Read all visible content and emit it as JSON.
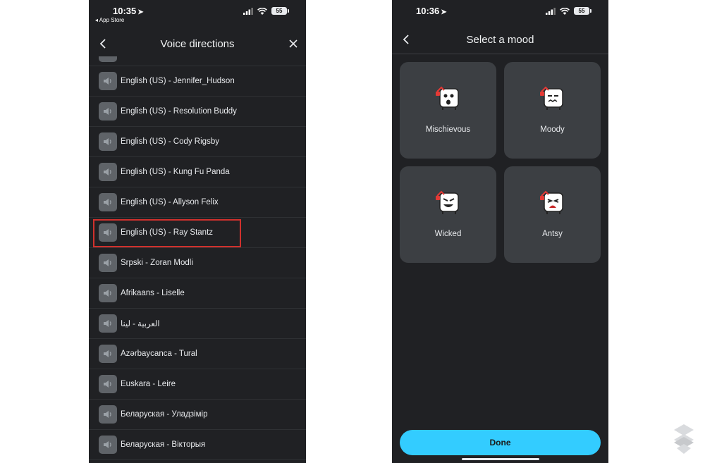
{
  "left_screen": {
    "status": {
      "time": "10:35",
      "back_to_app": "◂ App Store",
      "battery": "55"
    },
    "title": "Voice directions",
    "voices": [
      {
        "label": "English (US) - Jennifer_Hudson",
        "highlighted": false
      },
      {
        "label": "English (US) - Resolution Buddy",
        "highlighted": false
      },
      {
        "label": "English (US) - Cody Rigsby",
        "highlighted": false
      },
      {
        "label": "English (US) - Kung Fu Panda",
        "highlighted": false
      },
      {
        "label": "English (US) - Allyson Felix",
        "highlighted": false
      },
      {
        "label": "English (US) - Ray Stantz",
        "highlighted": true
      },
      {
        "label": "Srpski - Zoran Modli",
        "highlighted": false
      },
      {
        "label": "Afrikaans - Liselle",
        "highlighted": false
      },
      {
        "label": "العربية - لينا",
        "highlighted": false
      },
      {
        "label": "Azərbaycanca - Tural",
        "highlighted": false
      },
      {
        "label": "Euskara - Leire",
        "highlighted": false
      },
      {
        "label": "Беларуская - Уладзімір",
        "highlighted": false
      },
      {
        "label": "Беларуская - Вікторыя",
        "highlighted": false
      }
    ]
  },
  "right_screen": {
    "status": {
      "time": "10:36",
      "battery": "55"
    },
    "title": "Select a mood",
    "moods": [
      {
        "label": "Mischievous",
        "icon": "mischievous-mood-icon"
      },
      {
        "label": "Moody",
        "icon": "moody-mood-icon"
      },
      {
        "label": "Wicked",
        "icon": "wicked-mood-icon"
      },
      {
        "label": "Antsy",
        "icon": "antsy-mood-icon"
      }
    ],
    "done_label": "Done"
  },
  "colors": {
    "background": "#202124",
    "card": "#3c3f43",
    "accent": "#33ccff",
    "highlight_box": "#d0312d"
  }
}
